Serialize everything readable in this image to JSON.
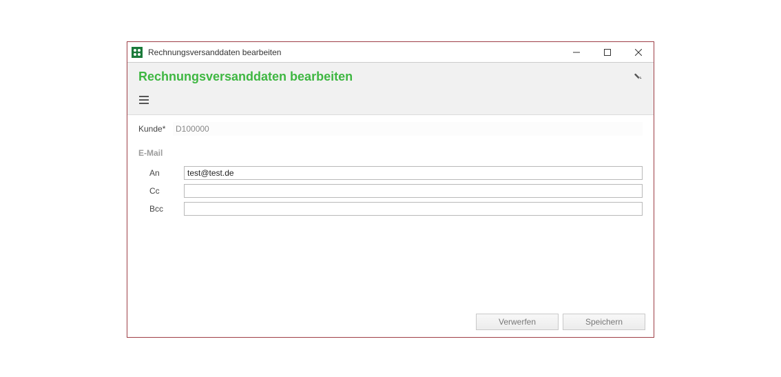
{
  "window": {
    "title": "Rechnungsversanddaten bearbeiten"
  },
  "header": {
    "title": "Rechnungsversanddaten bearbeiten"
  },
  "form": {
    "kunde_label": "Kunde*",
    "kunde_value": "D100000",
    "section_email": "E-Mail",
    "an_label": "An",
    "an_value": "test@test.de",
    "cc_label": "Cc",
    "cc_value": "",
    "bcc_label": "Bcc",
    "bcc_value": ""
  },
  "footer": {
    "discard": "Verwerfen",
    "save": "Speichern"
  }
}
